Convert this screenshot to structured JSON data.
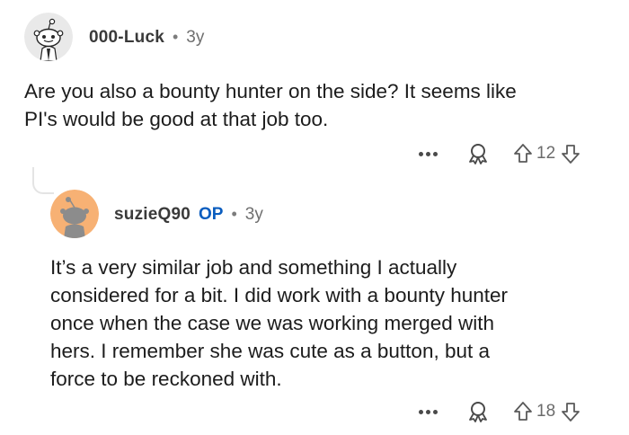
{
  "comments": [
    {
      "username": "000-Luck",
      "separator": "•",
      "timestamp": "3y",
      "body_lines": [
        "Are you also a bounty hunter on the side? It seems like",
        "PI's would be good at that job too."
      ],
      "more_label": "•••",
      "upvotes": "12"
    },
    {
      "username": "suzieQ90",
      "badge": "OP",
      "separator": "•",
      "timestamp": "3y",
      "body_lines": [
        "It’s a very similar job and something I actually",
        "considered for a bit. I did work with a bounty hunter",
        "once when the case we was working merged with",
        "hers. I remember she was cute as a button, but a",
        "force to be reckoned with."
      ],
      "more_label": "•••",
      "upvotes": "18"
    }
  ],
  "icons": {
    "avatar_1": "snoo-avatar",
    "avatar_2": "snoo-avatar-orange",
    "award": "award-icon",
    "upvote": "upvote-arrow-icon",
    "downvote": "downvote-arrow-icon",
    "more": "more-options-icon"
  },
  "colors": {
    "op_badge": "#0a5dbf",
    "avatar_2_bg": "#f7b174",
    "text": "#1c1c1c",
    "muted": "#6f6f6f"
  }
}
